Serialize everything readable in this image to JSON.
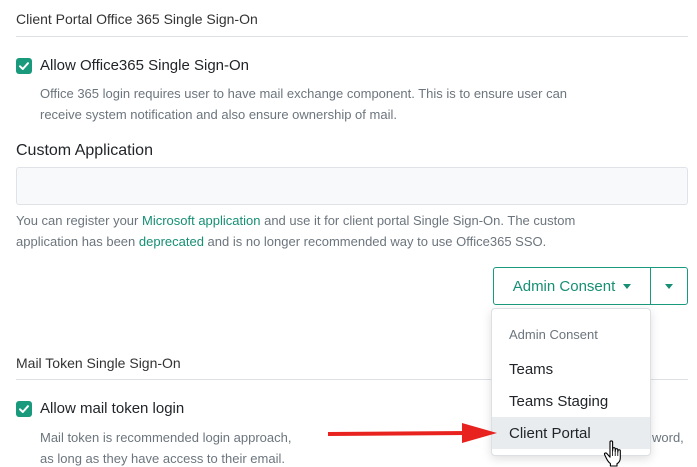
{
  "sections": {
    "office365": {
      "title": "Client Portal Office 365 Single Sign-On",
      "checkbox_label": "Allow Office365 Single Sign-On",
      "checked": true,
      "help_line1": "Office 365 login requires user to have mail exchange component. This is to ensure user can",
      "help_line2": "receive system notification and also ensure ownership of mail."
    },
    "custom_app": {
      "label": "Custom Application",
      "value": "",
      "placeholder": "",
      "help_part1": "You can register your ",
      "help_link1": "Microsoft application",
      "help_part2": " and use it for client portal Single Sign-On. The custom",
      "help_part3": "application has been ",
      "help_link2": "deprecated",
      "help_part4": " and is no longer recommended way to use Office365 SSO."
    },
    "mail_token": {
      "title": "Mail Token Single Sign-On",
      "checkbox_label": "Allow mail token login",
      "checked": true,
      "help_line1_start": "Mail token is recommended login approach,",
      "help_line1_end": "word,",
      "help_line2": "as long as they have access to their email."
    }
  },
  "split_button": {
    "label": "Admin Consent",
    "toggle_icon": "caret-down-icon"
  },
  "dropdown": {
    "header": "Admin Consent",
    "items": [
      "Teams",
      "Teams Staging",
      "Client Portal"
    ],
    "highlighted": "Client Portal"
  },
  "annotation": {
    "arrow_color": "#e8231f",
    "cursor_icon": "hand-pointer-icon"
  },
  "colors": {
    "accent": "#1a9a7c",
    "link": "#168f74",
    "muted_text": "#6c757d"
  }
}
